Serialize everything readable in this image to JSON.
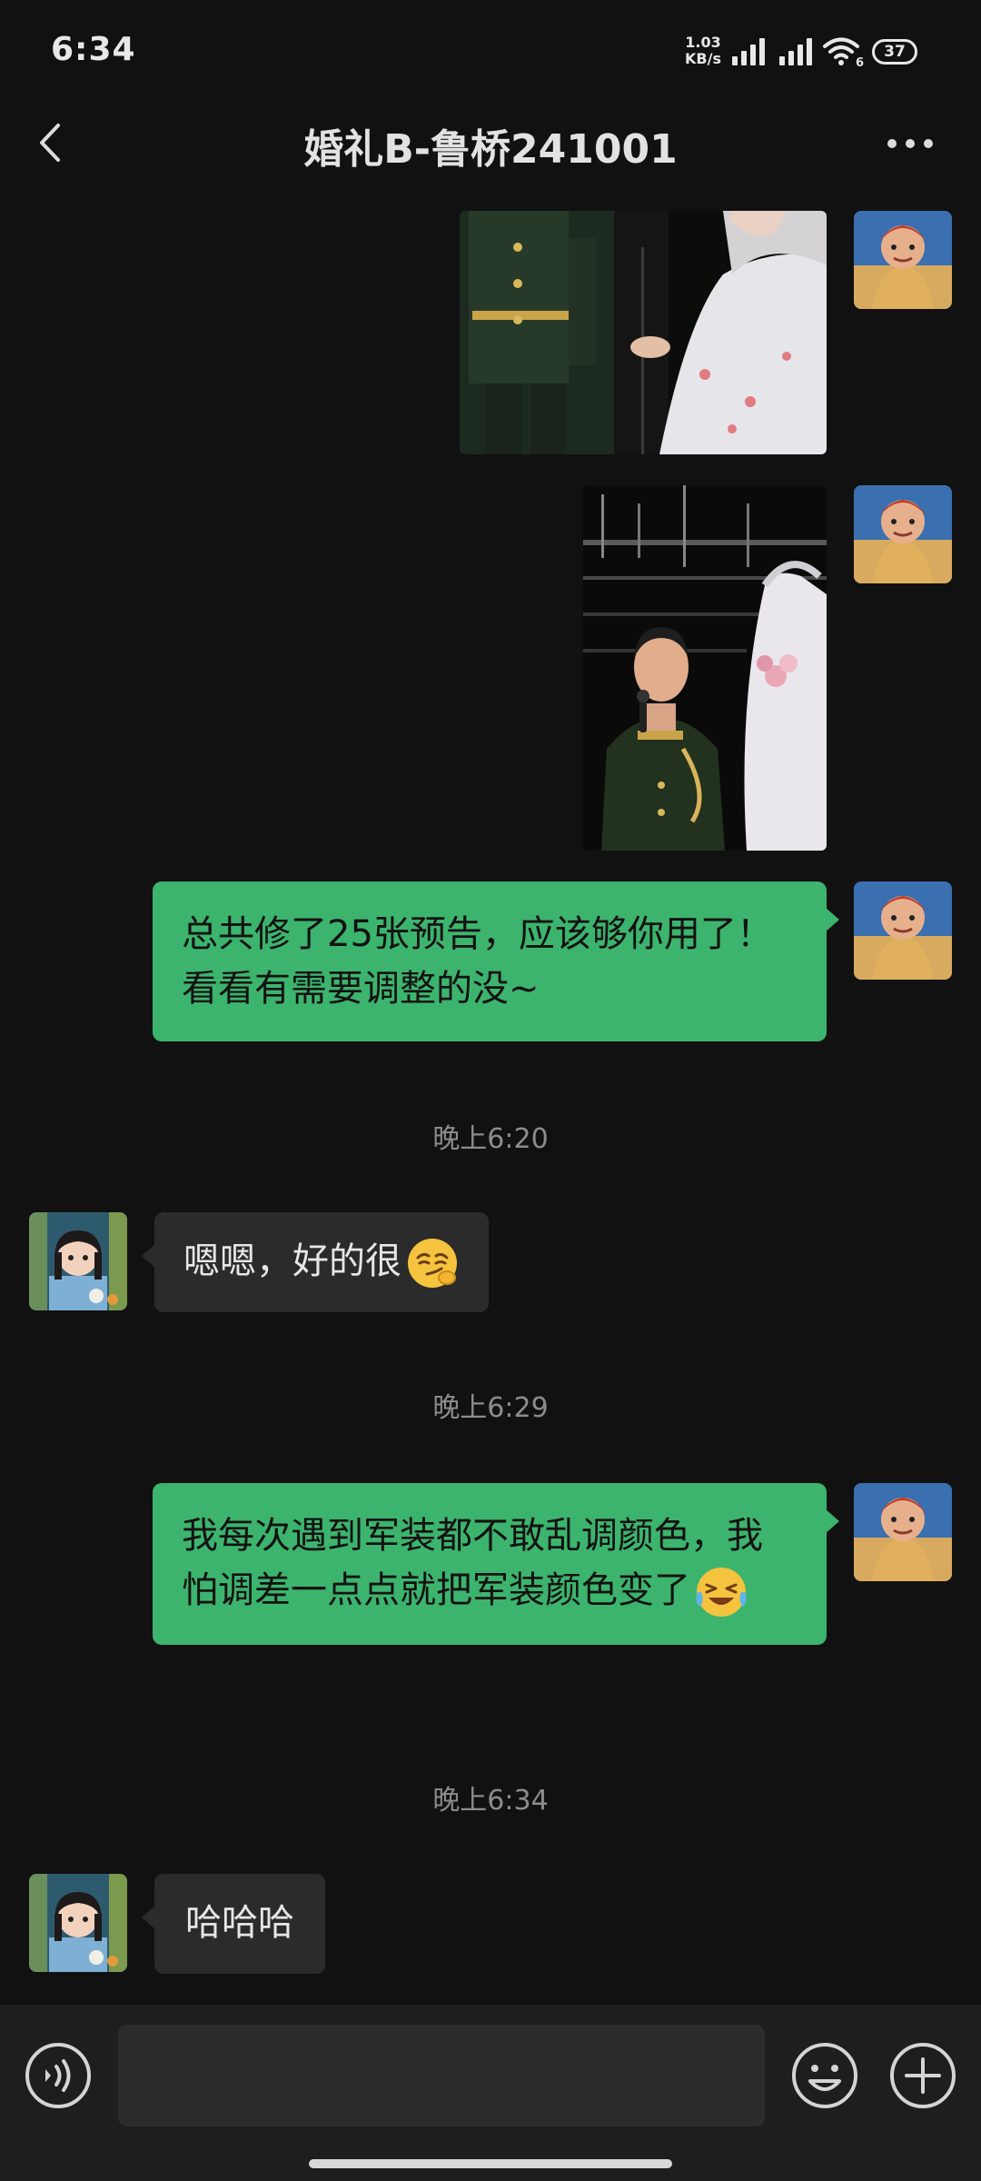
{
  "status_bar": {
    "time": "6:34",
    "net_speed_value": "1.03",
    "net_speed_unit": "KB/s",
    "wifi_label": "6",
    "battery": "37"
  },
  "nav": {
    "title": "婚礼B-鲁桥241001",
    "back_icon": "chevron-left-icon",
    "more_icon": "ellipsis-icon"
  },
  "messages": {
    "m3": {
      "text": "总共修了25张预告，应该够你用了！看看有需要调整的没~"
    },
    "t1": {
      "text": "晚上6:20"
    },
    "m4": {
      "text": "嗯嗯，好的很"
    },
    "t2": {
      "text": "晚上6:29"
    },
    "m5": {
      "text": "我每次遇到军装都不敢乱调颜色，我怕调差一点点就把军装颜色变了"
    },
    "t3": {
      "text": "晚上6:34"
    },
    "m6": {
      "text": "哈哈哈"
    }
  },
  "input_bar": {
    "value": "",
    "voice_icon": "voice-icon",
    "emoji_icon": "smiley-icon",
    "plus_icon": "plus-icon"
  },
  "colors": {
    "background": "#111111",
    "bubble_out": "#3cb46d",
    "bubble_in": "#2b2b2b",
    "timestamp": "#8c8c8c"
  }
}
